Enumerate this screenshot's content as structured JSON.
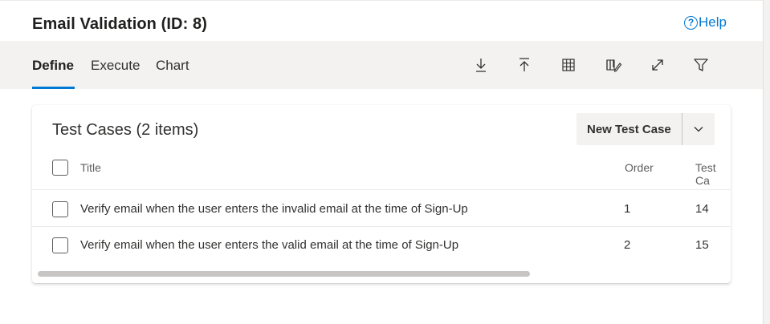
{
  "header": {
    "title": "Email Validation (ID: 8)",
    "help_label": "Help"
  },
  "tabs": [
    {
      "label": "Define",
      "active": true
    },
    {
      "label": "Execute",
      "active": false
    },
    {
      "label": "Chart",
      "active": false
    }
  ],
  "toolbar_icons": [
    "download-icon",
    "upload-icon",
    "grid-view-icon",
    "column-options-icon",
    "expand-icon",
    "filter-icon"
  ],
  "test_cases": {
    "title": "Test Cases (2 items)",
    "new_button_label": "New Test Case",
    "columns": {
      "title": "Title",
      "order": "Order",
      "test_case": "Test Ca"
    },
    "rows": [
      {
        "title": "Verify email when the user enters the invalid email at the time of Sign-Up",
        "order": "1",
        "test_case": "14"
      },
      {
        "title": "Verify email when the user enters the valid email at the time of Sign-Up",
        "order": "2",
        "test_case": "15"
      }
    ]
  },
  "colors": {
    "accent": "#0078d4",
    "toolbar_bg": "#f3f2f1"
  }
}
